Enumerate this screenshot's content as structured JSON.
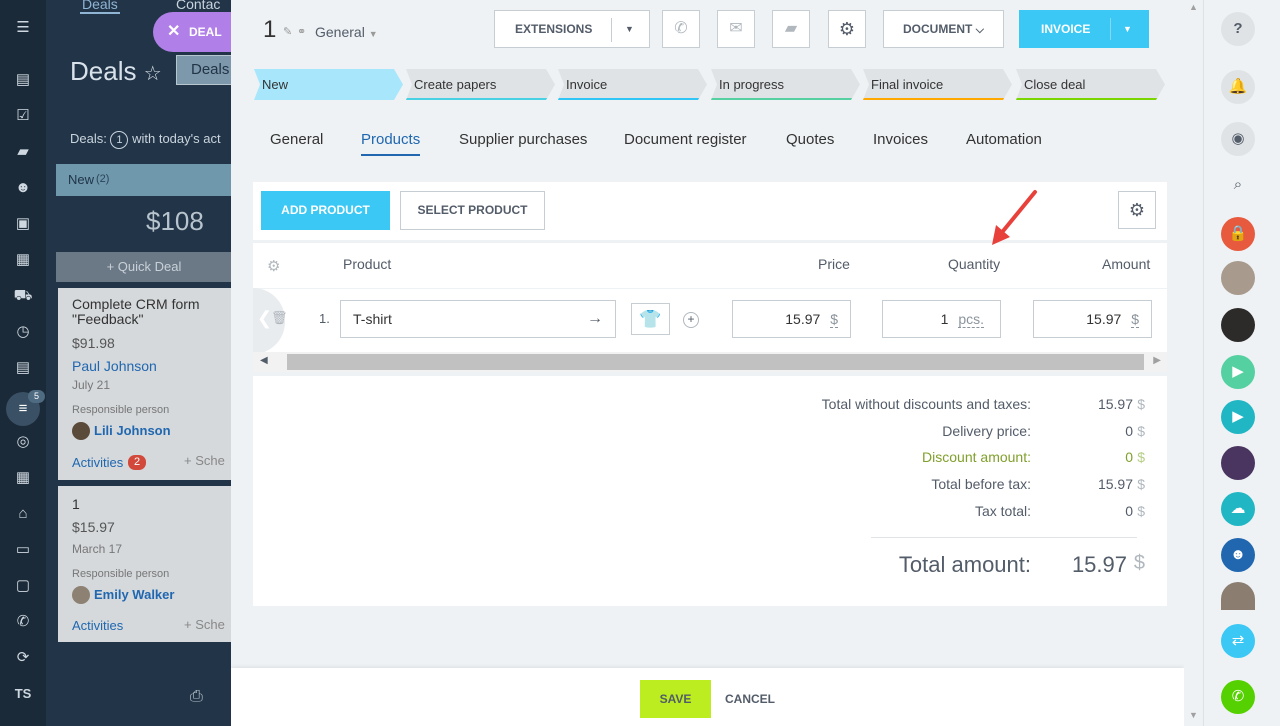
{
  "background": {
    "top_tabs": [
      "Deals",
      "Contac"
    ],
    "deal_chip": "DEAL",
    "title": "Deals",
    "deals_button": "Deals",
    "filter_text": "Deals:",
    "filter_count": "1",
    "filter_suffix": "with today's act",
    "column": {
      "name": "New",
      "count": "(2)",
      "total": "$108",
      "quick_deal": "+ Quick Deal"
    },
    "cards": [
      {
        "title": "Complete CRM form \"Feedback\"",
        "price": "$91.98",
        "contact": "Paul Johnson",
        "date": "July 21",
        "resp_label": "Responsible person",
        "resp_name": "Lili Johnson",
        "activities": "Activities",
        "activities_count": "2",
        "schedule": "+ Sche"
      },
      {
        "title": "1",
        "price": "$15.97",
        "contact": "",
        "date": "March 17",
        "resp_label": "Responsible person",
        "resp_name": "Emily Walker",
        "activities": "Activities",
        "activities_count": "",
        "schedule": "+ Sche"
      }
    ],
    "leftnav_badge": "5",
    "leftnav_bottom": "TS"
  },
  "header": {
    "deal_id": "1",
    "pipeline": "General",
    "extensions": "EXTENSIONS",
    "document": "DOCUMENT",
    "invoice": "INVOICE"
  },
  "stages": [
    "New",
    "Create papers",
    "Invoice",
    "In progress",
    "Final invoice",
    "Close deal"
  ],
  "tabs": [
    "General",
    "Products",
    "Supplier purchases",
    "Document register",
    "Quotes",
    "Invoices",
    "Automation"
  ],
  "products": {
    "add_button": "ADD PRODUCT",
    "select_button": "SELECT PRODUCT",
    "columns": {
      "product": "Product",
      "price": "Price",
      "quantity": "Quantity",
      "amount": "Amount"
    },
    "rows": [
      {
        "index": "1.",
        "name": "T-shirt",
        "price": "15.97",
        "currency": "$",
        "quantity": "1",
        "unit": "pcs.",
        "amount": "15.97",
        "amount_currency": "$"
      }
    ]
  },
  "summary": {
    "rows": [
      {
        "label": "Total without discounts and taxes:",
        "value": "15.97",
        "currency": "$"
      },
      {
        "label": "Delivery price:",
        "value": "0",
        "currency": "$"
      },
      {
        "label": "Discount amount:",
        "value": "0",
        "currency": "$"
      },
      {
        "label": "Total before tax:",
        "value": "15.97",
        "currency": "$"
      },
      {
        "label": "Tax total:",
        "value": "0",
        "currency": "$"
      }
    ],
    "total_label": "Total amount:",
    "total_value": "15.97",
    "total_currency": "$"
  },
  "footer": {
    "save": "SAVE",
    "cancel": "CANCEL"
  },
  "colors": {
    "accent": "#3bc8f5",
    "save": "#bbed21",
    "discount": "#80a02c",
    "active_tab": "#2067b0"
  }
}
